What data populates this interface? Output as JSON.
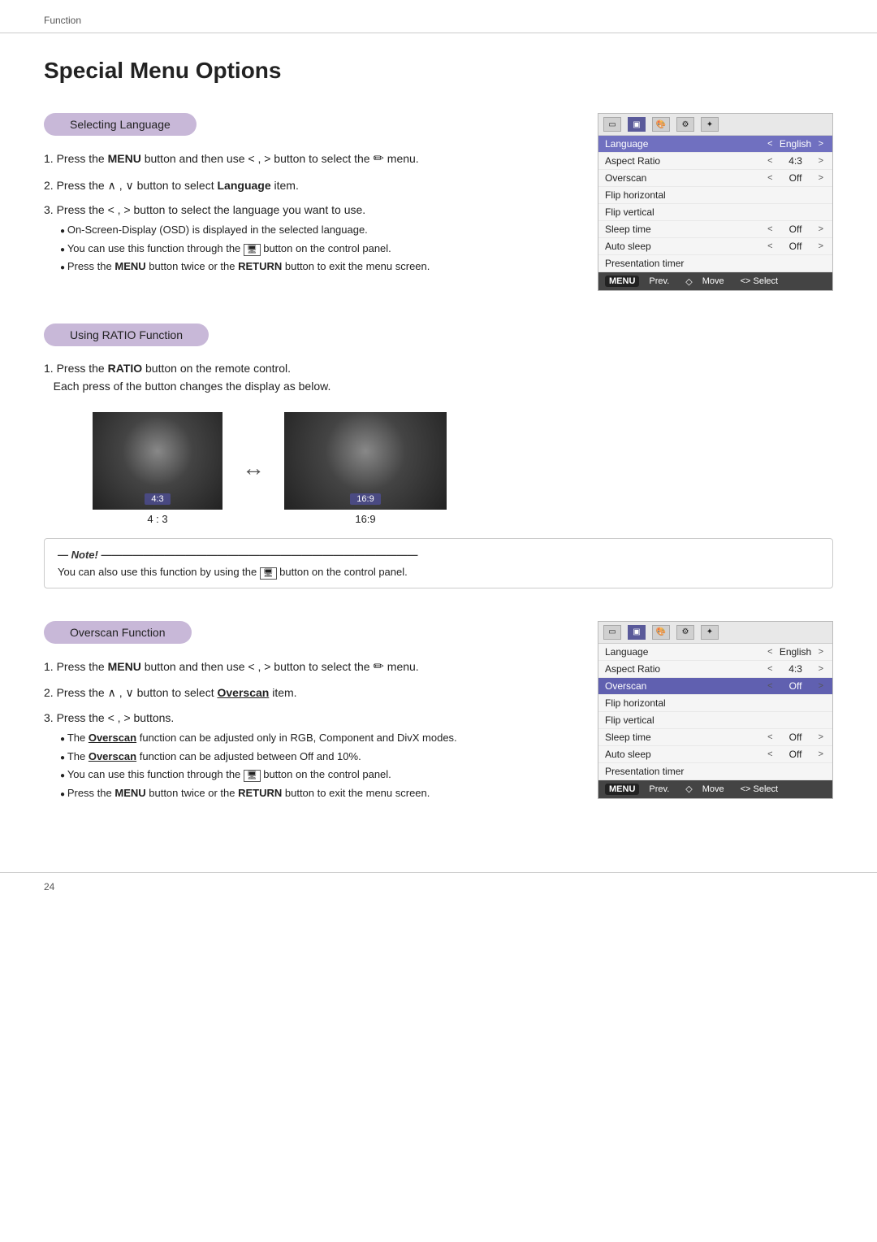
{
  "header": {
    "breadcrumb": "Function"
  },
  "page": {
    "title": "Special Menu Options"
  },
  "sections": {
    "selecting_language": {
      "header": "Selecting Language",
      "steps": [
        {
          "text_parts": [
            "Press the ",
            "MENU",
            " button and then use < , > button to select the ",
            "✏",
            " menu."
          ]
        },
        {
          "text_parts": [
            "Press the ∧ , ∨ button to select ",
            "Language",
            " item."
          ]
        },
        {
          "text_parts": [
            "Press the < , > button to select the language you want to use."
          ]
        }
      ],
      "bullets": [
        "On-Screen-Display (OSD) is displayed in the selected language.",
        "You can use this function through the  🖥  button on the control panel.",
        "Press the MENU button twice or the RETURN button to exit the menu screen."
      ]
    },
    "using_ratio": {
      "header": "Using RATIO Function",
      "step1_text1": "Press the ",
      "step1_bold": "RATIO",
      "step1_text2": " button on the remote control.",
      "step1_text3": "Each press of the button changes the display as below.",
      "image1_label": "4:3",
      "image2_label": "16:9",
      "caption1": "4 : 3",
      "caption2": "16:9",
      "note_title": "Note!",
      "note_text1": "You can also use this function by using the ",
      "note_text2": " button on the control panel."
    },
    "overscan": {
      "header": "Overscan Function",
      "steps": [
        {
          "text_parts": [
            "Press the ",
            "MENU",
            " button and then use < , > button to select the ",
            "✏",
            " menu."
          ]
        },
        {
          "text_parts": [
            "Press the ∧ , ∨ button to select ",
            "Overscan",
            " item."
          ]
        },
        {
          "text_parts": [
            "Press the < , > buttons."
          ]
        }
      ],
      "bullets": [
        "The Overscan function can be adjusted only in RGB, Component and DivX modes.",
        "The Overscan function can be adjusted between Off and 10%.",
        "You can use this function through the  🖥  button on the control panel.",
        "Press the MENU button twice or the RETURN button to exit the menu screen."
      ]
    }
  },
  "menu1": {
    "rows": [
      {
        "label": "Language",
        "arrow_left": "<",
        "value": "English",
        "arrow_right": ">",
        "highlight": "language"
      },
      {
        "label": "Aspect Ratio",
        "arrow_left": "<",
        "value": "4:3",
        "arrow_right": ">",
        "highlight": "none"
      },
      {
        "label": "Overscan",
        "arrow_left": "<",
        "value": "Off",
        "arrow_right": ">",
        "highlight": "none"
      },
      {
        "label": "Flip horizontal",
        "arrow_left": "",
        "value": "",
        "arrow_right": "",
        "highlight": "none"
      },
      {
        "label": "Flip vertical",
        "arrow_left": "",
        "value": "",
        "arrow_right": "",
        "highlight": "none"
      },
      {
        "label": "Sleep time",
        "arrow_left": "<",
        "value": "Off",
        "arrow_right": ">",
        "highlight": "none"
      },
      {
        "label": "Auto sleep",
        "arrow_left": "<",
        "value": "Off",
        "arrow_right": ">",
        "highlight": "none"
      },
      {
        "label": "Presentation timer",
        "arrow_left": "",
        "value": "",
        "arrow_right": "",
        "highlight": "none"
      }
    ],
    "footer": {
      "menu": "MENU",
      "prev": "Prev.",
      "move": "Move",
      "select": "<> Select"
    }
  },
  "menu2": {
    "rows": [
      {
        "label": "Language",
        "arrow_left": "<",
        "value": "English",
        "arrow_right": ">",
        "highlight": "none"
      },
      {
        "label": "Aspect Ratio",
        "arrow_left": "<",
        "value": "4:3",
        "arrow_right": ">",
        "highlight": "none"
      },
      {
        "label": "Overscan",
        "arrow_left": "<",
        "value": "Off",
        "arrow_right": ">",
        "highlight": "overscan"
      },
      {
        "label": "Flip horizontal",
        "arrow_left": "",
        "value": "",
        "arrow_right": "",
        "highlight": "none"
      },
      {
        "label": "Flip vertical",
        "arrow_left": "",
        "value": "",
        "arrow_right": "",
        "highlight": "none"
      },
      {
        "label": "Sleep time",
        "arrow_left": "<",
        "value": "Off",
        "arrow_right": ">",
        "highlight": "none"
      },
      {
        "label": "Auto sleep",
        "arrow_left": "<",
        "value": "Off",
        "arrow_right": ">",
        "highlight": "none"
      },
      {
        "label": "Presentation timer",
        "arrow_left": "",
        "value": "",
        "arrow_right": "",
        "highlight": "none"
      }
    ],
    "footer": {
      "menu": "MENU",
      "prev": "Prev.",
      "move": "Move",
      "select": "<> Select"
    }
  },
  "footer": {
    "page_number": "24"
  }
}
